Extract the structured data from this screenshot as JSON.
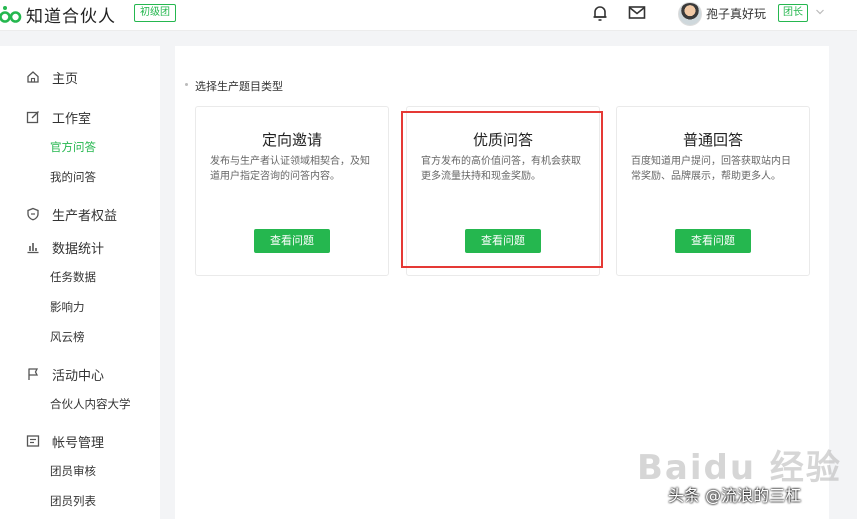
{
  "header": {
    "logo_text": "知道合伙人",
    "level_badge": "初级团",
    "user_name": "孢子真好玩",
    "role_badge": "团长",
    "icons": [
      "bell-icon",
      "mail-icon",
      "chevron-down-icon"
    ]
  },
  "sidebar": {
    "home": "主页",
    "studio": "工作室",
    "studio_items": [
      "官方问答",
      "我的问答"
    ],
    "producer_rights": "生产者权益",
    "stats": "数据统计",
    "stats_items": [
      "任务数据",
      "影响力",
      "风云榜"
    ],
    "events": "活动中心",
    "events_items": [
      "合伙人内容大学"
    ],
    "account": "帐号管理",
    "account_items": [
      "团员审核",
      "团员列表"
    ]
  },
  "main": {
    "section_title": "选择生产题目类型",
    "cards": [
      {
        "title": "定向邀请",
        "desc": "发布与生产者认证领域相契合，及知道用户指定咨询的问答内容。",
        "button": "查看问题"
      },
      {
        "title": "优质问答",
        "desc": "官方发布的高价值问答，有机会获取更多流量扶持和现金奖励。",
        "button": "查看问题"
      },
      {
        "title": "普通回答",
        "desc": "百度知道用户提问，回答获取站内日常奖励、品牌展示，帮助更多人。",
        "button": "查看问题"
      }
    ]
  },
  "watermarks": {
    "baidu": "Baidu 经验",
    "toutiao": "头条 @流浪的三杠"
  },
  "colors": {
    "accent": "#25b74f",
    "highlight": "#e53935"
  }
}
